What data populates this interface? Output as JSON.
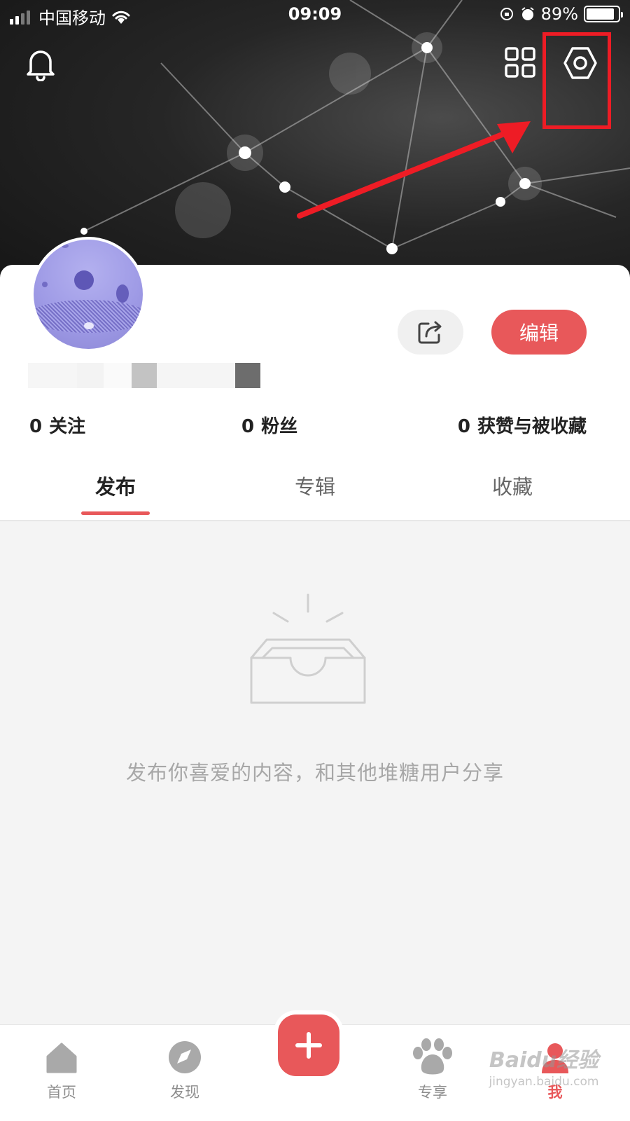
{
  "status_bar": {
    "carrier": "中国移动",
    "time": "09:09",
    "battery": "89%"
  },
  "header": {
    "icons": [
      "bell-icon",
      "grid-icon",
      "settings-icon"
    ]
  },
  "profile": {
    "edit_label": "编辑",
    "stats": [
      {
        "count": "0",
        "label": "关注"
      },
      {
        "count": "0",
        "label": "粉丝"
      },
      {
        "count": "0",
        "label": "获赞与被收藏"
      }
    ]
  },
  "tabs": [
    {
      "label": "发布",
      "active": true
    },
    {
      "label": "专辑",
      "active": false
    },
    {
      "label": "收藏",
      "active": false
    }
  ],
  "empty_state": {
    "message": "发布你喜爱的内容，和其他堆糖用户分享"
  },
  "bottom_nav": {
    "items": [
      {
        "label": "首页",
        "icon": "home-icon"
      },
      {
        "label": "发现",
        "icon": "compass-icon"
      },
      {
        "label": "专享",
        "icon": "paw-icon"
      },
      {
        "label": "我",
        "icon": "user-icon"
      }
    ],
    "publish_icon": "plus-icon"
  },
  "watermark": {
    "main": "Baidu经验",
    "sub": "jingyan.baidu.com"
  },
  "colors": {
    "accent": "#e8585a",
    "annotation": "#ee1c25"
  }
}
